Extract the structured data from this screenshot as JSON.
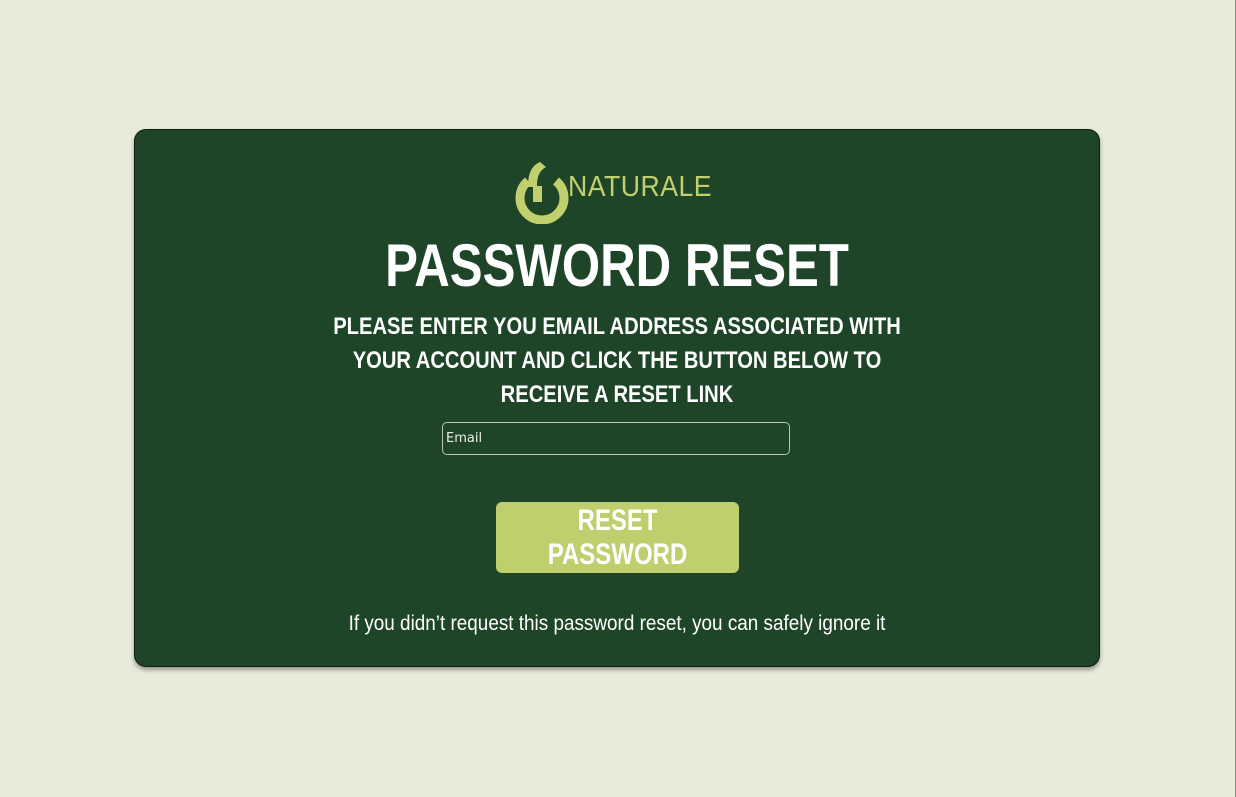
{
  "brand": {
    "name": "NATURALE",
    "logo_icon": "power-leaf-icon",
    "accent_color": "#c0d06e"
  },
  "page": {
    "title": "PASSWORD RESET",
    "instructions": "PLEASE ENTER YOU EMAIL ADDRESS ASSOCIATED WITH YOUR ACCOUNT AND CLICK THE BUTTON BELOW TO RECEIVE A RESET LINK",
    "background_color": "#e8eada",
    "card_color": "#1e4528"
  },
  "form": {
    "email_placeholder": "Email",
    "email_value": "",
    "submit_label": "RESET PASSWORD",
    "button_color": "#bfcf6d"
  },
  "footer": {
    "note": "If you didn’t request this password reset, you can safely ignore it"
  }
}
